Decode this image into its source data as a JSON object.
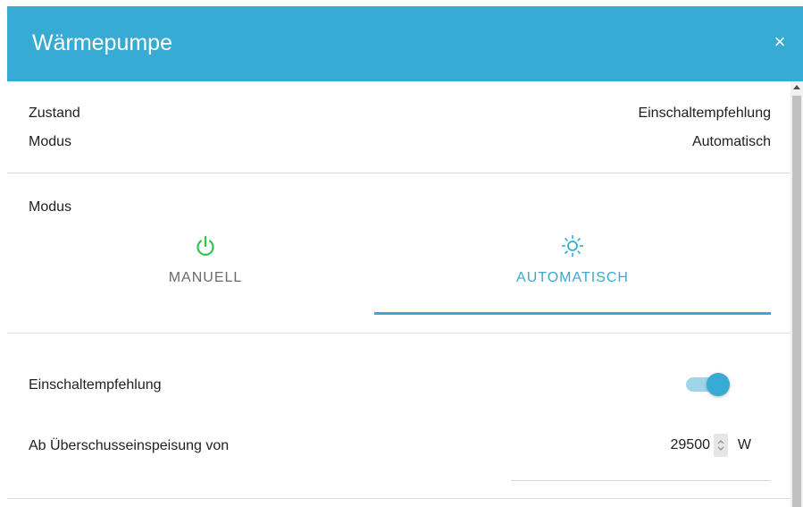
{
  "dialog": {
    "title": "Wärmepumpe",
    "close_label": "×",
    "accent_color": "#37abd3"
  },
  "status": {
    "state_label": "Zustand",
    "state_value": "Einschaltempfehlung",
    "mode_label": "Modus",
    "mode_value": "Automatisch"
  },
  "mode_selector": {
    "label": "Modus",
    "tabs": [
      {
        "label": "MANUELL",
        "icon": "power-icon",
        "icon_color": "#2ec44f",
        "selected": false
      },
      {
        "label": "AUTOMATISCH",
        "icon": "sun-icon",
        "icon_color": "#37abd3",
        "selected": true
      }
    ]
  },
  "settings": {
    "recommendation_label": "Einschaltempfehlung",
    "recommendation_enabled": true,
    "surplus_label": "Ab Überschusseinspeisung von",
    "surplus_value": "29500",
    "surplus_unit": "W"
  }
}
